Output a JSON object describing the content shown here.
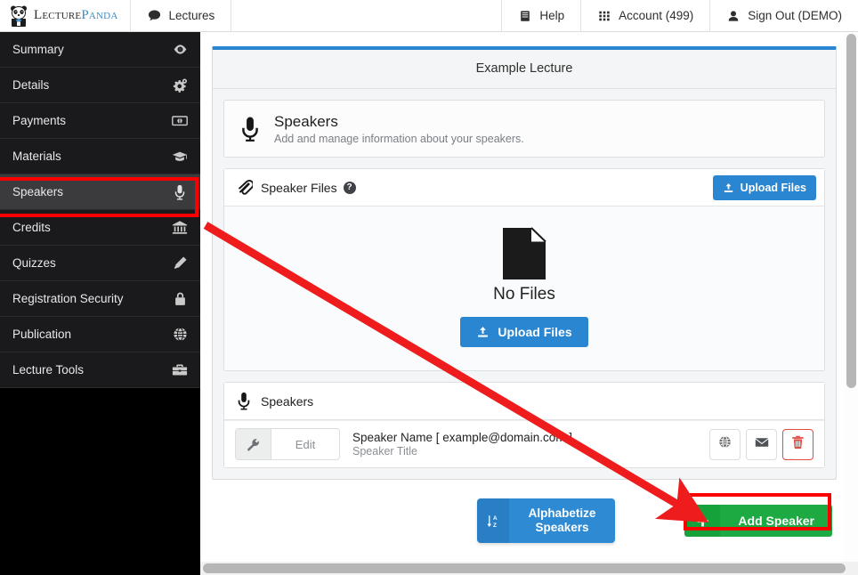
{
  "topnav": {
    "brand": {
      "word1": "Lecture",
      "word2": "Panda",
      "icon": "panda-logo-icon"
    },
    "left_items": [
      {
        "label": "Lectures",
        "icon": "comment-icon"
      }
    ],
    "right_items": [
      {
        "label": "Help",
        "icon": "book-icon"
      },
      {
        "label": "Account (499)",
        "icon": "grid-apps-icon"
      },
      {
        "label": "Sign Out (DEMO)",
        "icon": "user-icon"
      }
    ]
  },
  "sidebar": {
    "items": [
      {
        "label": "Summary",
        "icon": "eye-icon",
        "active": false
      },
      {
        "label": "Details",
        "icon": "gears-icon",
        "active": false
      },
      {
        "label": "Payments",
        "icon": "money-bill-icon",
        "active": false
      },
      {
        "label": "Materials",
        "icon": "graduation-cap-icon",
        "active": false
      },
      {
        "label": "Speakers",
        "icon": "microphone-icon",
        "active": true
      },
      {
        "label": "Credits",
        "icon": "bank-icon",
        "active": false
      },
      {
        "label": "Quizzes",
        "icon": "pencil-icon",
        "active": false
      },
      {
        "label": "Registration Security",
        "icon": "lock-icon",
        "active": false
      },
      {
        "label": "Publication",
        "icon": "globe-icon",
        "active": false
      },
      {
        "label": "Lecture Tools",
        "icon": "briefcase-icon",
        "active": false
      }
    ]
  },
  "main": {
    "card_title": "Example Lecture",
    "intro": {
      "icon": "microphone-icon",
      "heading": "Speakers",
      "subtext": "Add and manage information about your speakers."
    },
    "speaker_files": {
      "icon": "paperclip-icon",
      "title": "Speaker Files",
      "help_glyph": "?",
      "upload_top_label": "Upload Files",
      "upload_top_icon": "upload-icon",
      "empty_icon": "file-icon",
      "empty_label": "No Files",
      "upload_main_label": "Upload Files",
      "upload_main_icon": "upload-icon"
    },
    "speakers_list": {
      "icon": "microphone-icon",
      "title": "Speakers",
      "rows": [
        {
          "edit_label": "Edit",
          "edit_icon": "wrench-icon",
          "name": "Speaker Name [ example@domain.com ]",
          "title": "Speaker Title",
          "actions": [
            {
              "icon": "globe-icon",
              "name": "website-button"
            },
            {
              "icon": "envelope-icon",
              "name": "email-button"
            },
            {
              "icon": "trash-icon",
              "name": "delete-button"
            }
          ]
        }
      ]
    },
    "footer": {
      "alphabetize_label_line1": "Alphabetize",
      "alphabetize_label_line2": "Speakers",
      "alphabetize_icon": "sort-alpha-icon",
      "add_speaker_label": "Add Speaker",
      "add_speaker_icon": "plus-icon"
    }
  },
  "annotations": {
    "highlight_color": "#fb0000",
    "arrow_color": "#ee1c1c",
    "highlight_targets": [
      "sidebar-item-speakers",
      "add-speaker-button"
    ]
  },
  "colors": {
    "accent_blue": "#2a86d1",
    "accent_green": "#1eaa42",
    "danger_red": "#e24a43",
    "sidebar_bg": "#1a1a1c",
    "sidebar_active": "#3b3b3d"
  }
}
